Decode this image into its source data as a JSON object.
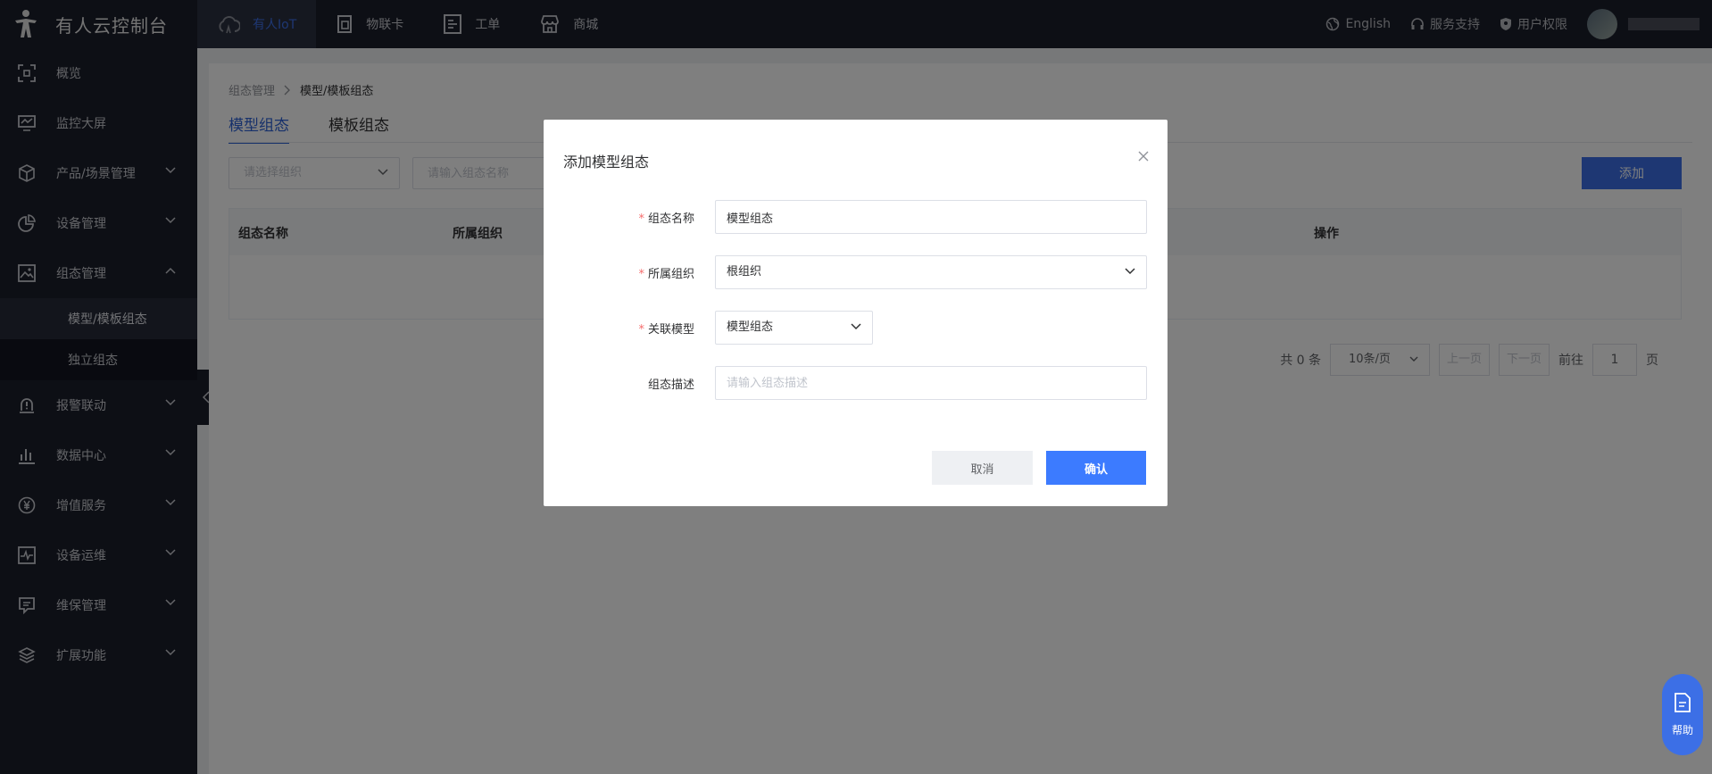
{
  "app": {
    "title": "有人云控制台"
  },
  "topnav": [
    {
      "label": "有人IoT",
      "icon": "cloud-icon",
      "active": true
    },
    {
      "label": "物联卡",
      "icon": "sim-card-icon"
    },
    {
      "label": "工单",
      "icon": "ticket-icon"
    },
    {
      "label": "商城",
      "icon": "store-icon"
    }
  ],
  "topright": {
    "language": "English",
    "support": "服务支持",
    "permissions": "用户权限"
  },
  "sidebar": {
    "items": [
      {
        "label": "概览",
        "icon": "overview-icon"
      },
      {
        "label": "监控大屏",
        "icon": "monitor-icon"
      },
      {
        "label": "产品/场景管理",
        "icon": "cube-icon"
      },
      {
        "label": "设备管理",
        "icon": "pie-chart-icon"
      },
      {
        "label": "组态管理",
        "icon": "image-icon"
      },
      {
        "label": "报警联动",
        "icon": "alarm-icon"
      },
      {
        "label": "数据中心",
        "icon": "bar-chart-icon"
      },
      {
        "label": "增值服务",
        "icon": "yen-icon"
      },
      {
        "label": "设备运维",
        "icon": "pulse-icon"
      },
      {
        "label": "维保管理",
        "icon": "maintenance-icon"
      },
      {
        "label": "扩展功能",
        "icon": "layers-icon"
      }
    ],
    "subitems": [
      {
        "label": "模型/模板组态",
        "active": true
      },
      {
        "label": "独立组态"
      }
    ]
  },
  "breadcrumb": {
    "parent": "组态管理",
    "current": "模型/模板组态"
  },
  "tabs": [
    {
      "label": "模型组态",
      "active": true
    },
    {
      "label": "模板组态"
    }
  ],
  "filters": {
    "org_placeholder": "请选择组织",
    "name_placeholder": "请输入组态名称",
    "add_label": "添加"
  },
  "table": {
    "columns": [
      "组态名称",
      "所属组织",
      "操作"
    ]
  },
  "pager": {
    "total": "共 0 条",
    "page_size": "10条/页",
    "prev": "上一页",
    "next": "下一页",
    "goto": "前往",
    "page": "1",
    "page_unit": "页"
  },
  "dialog": {
    "title": "添加模型组态",
    "fields": {
      "name": {
        "label": "组态名称",
        "value": "模型组态",
        "required": true
      },
      "org": {
        "label": "所属组织",
        "value": "根组织",
        "required": true
      },
      "model": {
        "label": "关联模型",
        "value": "模型组态",
        "required": true
      },
      "desc": {
        "label": "组态描述",
        "placeholder": "请输入组态描述",
        "required": false
      }
    },
    "cancel": "取消",
    "confirm": "确认"
  },
  "help": {
    "label": "帮助"
  }
}
